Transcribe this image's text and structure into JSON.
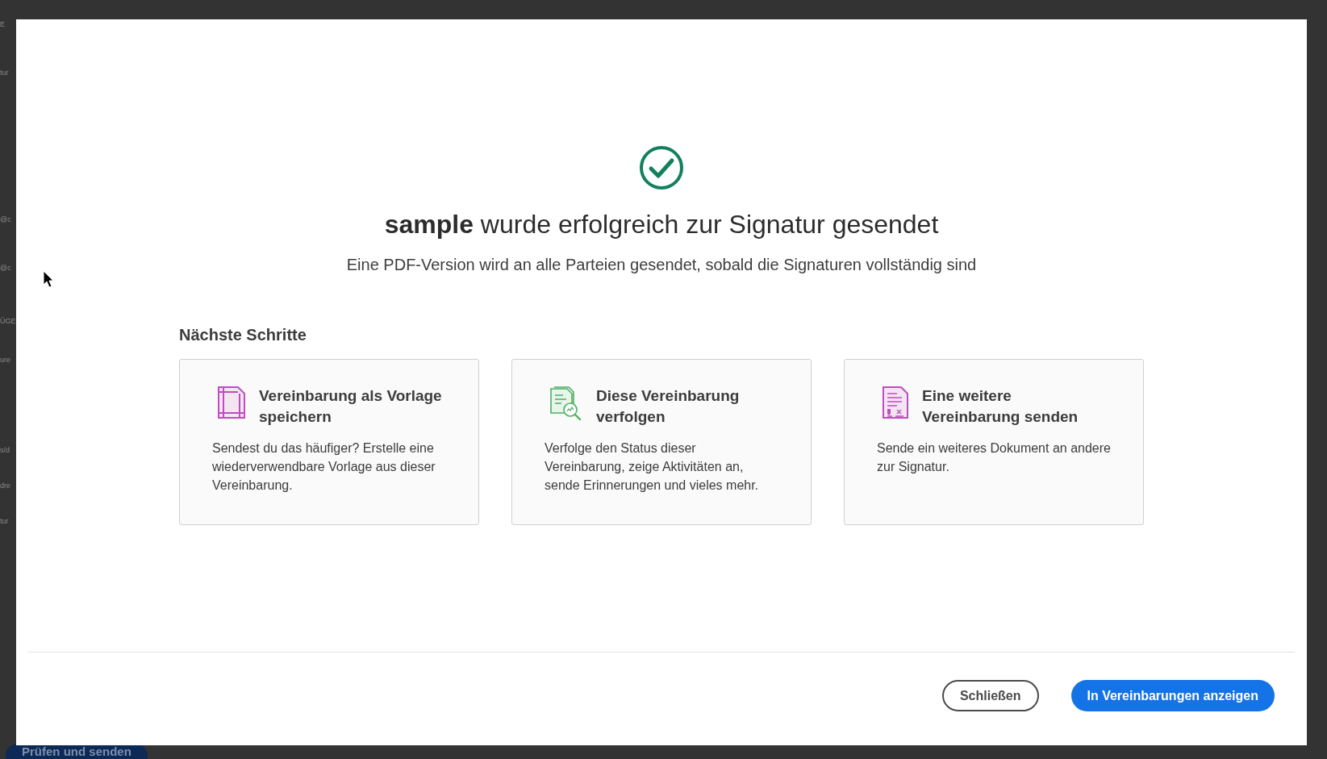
{
  "background": {
    "fragments": [
      "E",
      "tur",
      "@c",
      "@c",
      "ÜGE",
      "ure",
      "s/d",
      "dre",
      "tur"
    ],
    "bottom_button": "Prüfen und senden"
  },
  "dialog": {
    "title": "**sample** wurde erfolgreich zur Signatur gesendet",
    "subtitle": "Eine PDF-Version wird an alle Parteien gesendet, sobald die Signaturen vollständig sind",
    "section_title": "Nächste Schritte",
    "cards": [
      {
        "kind": "template",
        "title": "Vereinbarung als Vorlage speichern",
        "description": "Sendest du das häufiger? Erstelle eine wiederverwendbare Vorlage aus dieser Vereinbarung."
      },
      {
        "kind": "track",
        "title": "Diese Vereinbarung verfolgen",
        "description": "Verfolge den Status dieser Vereinbarung, zeige Aktivitäten an, sende Erinnerungen und vieles mehr."
      },
      {
        "kind": "send",
        "title": "Eine weitere Vereinbarung senden",
        "description": "Sende ein weiteres Dokument an andere zur Signatur."
      }
    ],
    "buttons": [
      {
        "kind": "secondary",
        "label": "Schließen"
      },
      {
        "kind": "primary",
        "label": "In Vereinbarungen anzeigen"
      }
    ]
  }
}
